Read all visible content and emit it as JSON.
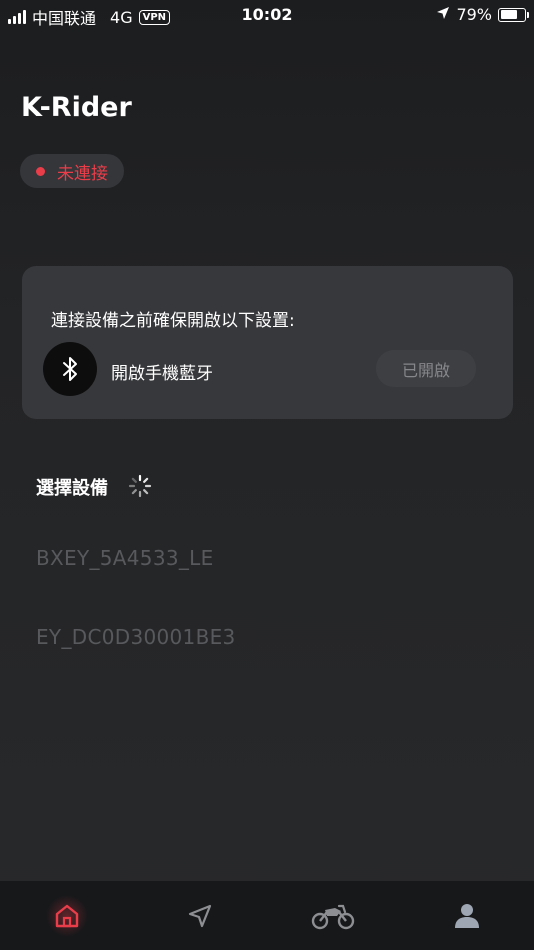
{
  "status_bar": {
    "carrier": "中国联通",
    "network": "4G",
    "vpn": "VPN",
    "time": "10:02",
    "battery": "79%",
    "battery_level": 0.79
  },
  "header": {
    "title": "K-Rider",
    "connection_status": "未連接"
  },
  "prerequisite_card": {
    "title": "連接設備之前確保開啟以下設置:",
    "bluetooth_label": "開啟手機藍牙",
    "bluetooth_status": "已開啟"
  },
  "devices": {
    "title": "選擇設備",
    "items": [
      {
        "name": "BXEY_5A4533_LE"
      },
      {
        "name": "EY_DC0D30001BE3"
      }
    ]
  },
  "tab_bar": {
    "items": [
      {
        "icon": "home-icon",
        "active": true
      },
      {
        "icon": "navigation-icon",
        "active": false
      },
      {
        "icon": "motorcycle-icon",
        "active": false
      },
      {
        "icon": "profile-icon",
        "active": false
      }
    ]
  },
  "colors": {
    "accent_red": "#ea3d4a",
    "background": "#222325",
    "card": "#37383b",
    "muted_text": "#58595c"
  }
}
